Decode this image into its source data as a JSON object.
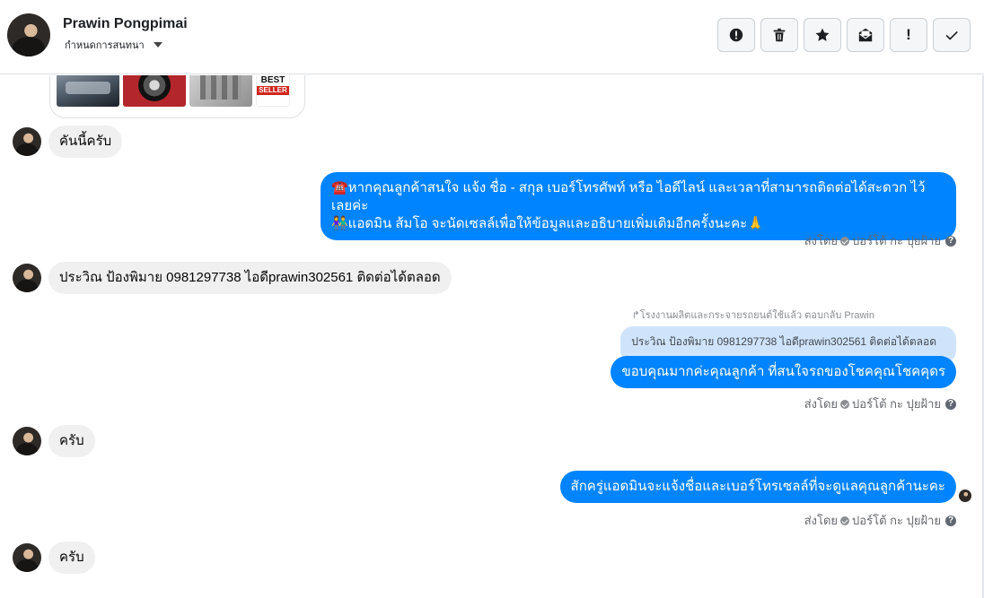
{
  "header": {
    "name": "Prawin Pongpimai",
    "label_menu": "กำหนดการสนทนา",
    "actions": [
      {
        "icon": "alert-circle-icon",
        "glyph": ""
      },
      {
        "icon": "trash-icon",
        "glyph": ""
      },
      {
        "icon": "star-icon",
        "glyph": ""
      },
      {
        "icon": "envelope-icon",
        "glyph": ""
      },
      {
        "icon": "exclamation-icon",
        "glyph": "!"
      },
      {
        "icon": "check-icon",
        "glyph": ""
      }
    ]
  },
  "image_card": {
    "badge_line1": "BEST",
    "badge_line2": "SELLER"
  },
  "messages": {
    "m1": {
      "text": "คันนี้ครับ"
    },
    "m2": {
      "line1": "☎️หากคุณลูกค้าสนใจ แจ้ง ชื่อ - สกุล เบอร์โทรศัพท์ หรือ ไอดีไลน์ และเวลาที่สามารถติดต่อได้สะดวก ไว้เลยค่ะ",
      "line2": "👫แอดมิน ส้มโอ จะนัดเซลล์เพื่อให้ข้อมูลและอธิบายเพิ่มเติมอีกครั้งนะคะ🙏"
    },
    "m3": {
      "text": "ประวิณ ป้องพิมาย 0981297738  ไอดีprawin302561 ติดต่อได้ตลอด"
    },
    "m4": {
      "reply_meta": "↱โรงงานผลิตและกระจายรถยนต์ใช้แล้ว ตอบกลับ Prawin",
      "quoted": "ประวิณ ป้องพิมาย 0981297738 ไอดีprawin302561 ติดต่อได้ตลอด",
      "text": "ขอบคุณมากค่ะคุณลูกค้า ที่สนใจรถของโชคคุณโชคคุดร"
    },
    "m5": {
      "text": "ครับ"
    },
    "m6": {
      "text": "สักครู่แอดมินจะแจ้งชื่อและเบอร์โทรเซลล์ที่จะดูแลคุณลูกค้านะคะ"
    },
    "m7": {
      "text": "ครับ"
    }
  },
  "sent_by": {
    "prefix": "ส่งโดย",
    "sender": "ปอร์โต้ กะ ปุยฝ้าย",
    "help": "?"
  },
  "colors": {
    "outgoing_bubble": "#0084ff",
    "incoming_bubble": "#f0f0f0",
    "quoted_bubble": "#cfe4fb"
  }
}
